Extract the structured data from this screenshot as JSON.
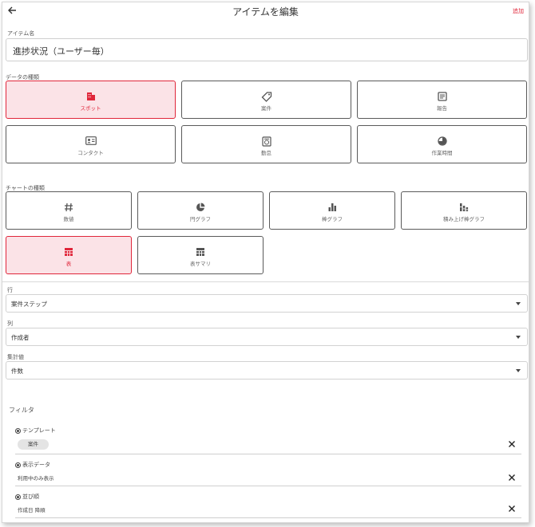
{
  "header": {
    "title": "アイテムを編集",
    "add_label": "追加"
  },
  "item_name": {
    "label": "アイテム名",
    "value": "進捗状況（ユーザー毎）"
  },
  "data_types": {
    "label": "データの種類",
    "items": [
      {
        "label": "スポット",
        "icon": "building-icon",
        "selected": true
      },
      {
        "label": "案件",
        "icon": "tag-icon",
        "selected": false
      },
      {
        "label": "報告",
        "icon": "report-icon",
        "selected": false
      },
      {
        "label": "コンタクト",
        "icon": "contact-card-icon",
        "selected": false
      },
      {
        "label": "勤怠",
        "icon": "timecard-icon",
        "selected": false
      },
      {
        "label": "作業時間",
        "icon": "clock-icon",
        "selected": false
      }
    ]
  },
  "chart_types": {
    "label": "チャートの種類",
    "items": [
      {
        "label": "数値",
        "icon": "hash-icon",
        "selected": false
      },
      {
        "label": "円グラフ",
        "icon": "pie-chart-icon",
        "selected": false
      },
      {
        "label": "棒グラフ",
        "icon": "bar-chart-icon",
        "selected": false
      },
      {
        "label": "積み上げ棒グラフ",
        "icon": "stacked-bar-icon",
        "selected": false
      },
      {
        "label": "表",
        "icon": "table-icon",
        "selected": true
      },
      {
        "label": "表サマリ",
        "icon": "table-summary-icon",
        "selected": false
      }
    ]
  },
  "rows": {
    "label": "行",
    "value": "案件ステップ"
  },
  "columns": {
    "label": "列",
    "value": "作成者"
  },
  "aggregate": {
    "label": "集計値",
    "value": "件数"
  },
  "filter": {
    "label": "フィルタ",
    "template": {
      "title": "テンプレート",
      "chip": "案件"
    },
    "display_data": {
      "title": "表示データ",
      "value": "利用中のみ表示"
    },
    "sort": {
      "title": "並び順",
      "value": "作成日 降順"
    }
  },
  "colors": {
    "accent": "#e0263a",
    "selected_bg": "#fbe3e7"
  }
}
